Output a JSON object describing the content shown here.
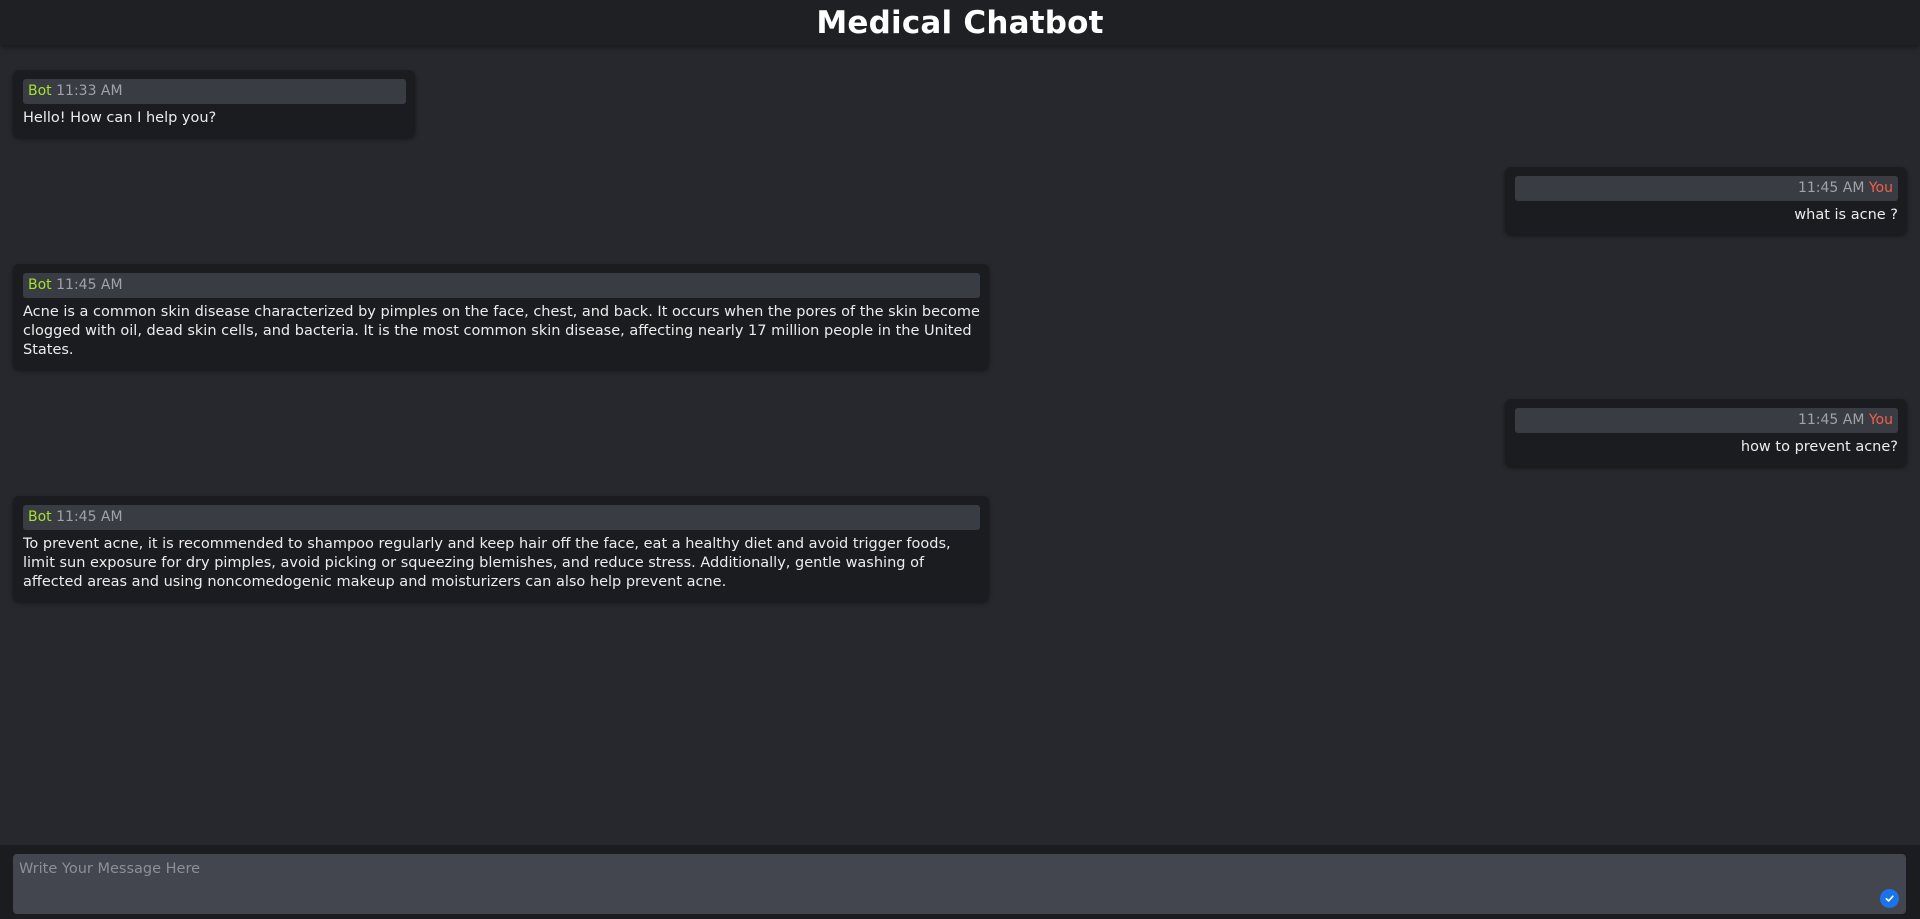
{
  "app": {
    "title": "Medical Chatbot"
  },
  "messages": [
    {
      "sender": "Bot",
      "time": "11:33 AM",
      "text": "Hello! How can I help you?"
    },
    {
      "sender": "You",
      "time": "11:45 AM",
      "text": "what is acne ?"
    },
    {
      "sender": "Bot",
      "time": "11:45 AM",
      "text": "Acne is a common skin disease characterized by pimples on the face, chest, and back. It occurs when the pores of the skin become clogged with oil, dead skin cells, and bacteria. It is the most common skin disease, affecting nearly 17 million people in the United States."
    },
    {
      "sender": "You",
      "time": "11:45 AM",
      "text": "how to prevent acne?"
    },
    {
      "sender": "Bot",
      "time": "11:45 AM",
      "text": "To prevent acne, it is recommended to shampoo regularly and keep hair off the face, eat a healthy diet and avoid trigger foods, limit sun exposure for dry pimples, avoid picking or squeezing blemishes, and reduce stress. Additionally, gentle washing of affected areas and using noncomedogenic makeup and moisturizers can also help prevent acne."
    }
  ],
  "composer": {
    "placeholder": "Write Your Message Here",
    "value": "",
    "send_icon": "check-circle-icon"
  },
  "colors": {
    "background": "#27282d",
    "header_bg": "#1f2024",
    "bubble_bg": "#1b1c20",
    "meta_bg": "#3a3c43",
    "bot_name": "#a6e22e",
    "user_name": "#f0614a",
    "input_bg": "#44464f",
    "send_button": "#1a73e8"
  }
}
